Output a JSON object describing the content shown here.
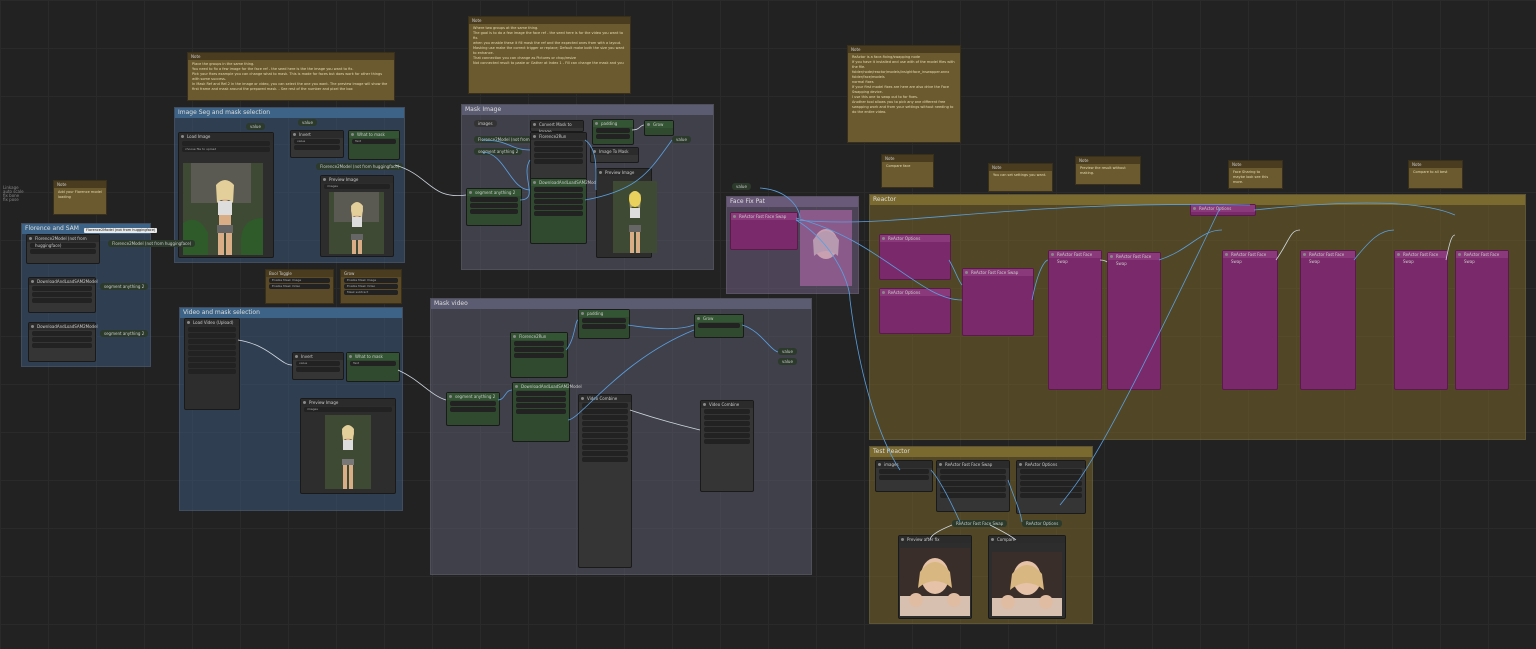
{
  "groups": {
    "image_mask_selection": "Image Seg and mask selection",
    "mask_image": "Mask Image",
    "face_fix": "Face Fix Pat",
    "reactor": "Reactor",
    "florence_sam": "Florence and SAM",
    "video_mask_selection": "Video and mask selection",
    "mask_video": "Mask video",
    "test_reactor": "Test Reactor"
  },
  "notes": {
    "title": "Note",
    "left_small": "Add your Florence model loading",
    "image_seg": "Place the groups in the same thing.\nYou need to fix a few image for the face ref - the seed here is the the image you want to fix.\nPick your fixes example you can change what to mask. This is made for faces but does work for other things with some success.\nIn Mask Ref and Ref-2 in the image or video, you can select the one you want. The preview image will show the first frame and mask around the prepared mask. - See rest of the number and pixel the box",
    "mask_image": "Where two groups at the same thing.\nThe goal is to do a few image the face ref - the seed here is for the video you want to fix.\nwhen you enable these it fill mask the ref and the expected ones from with a layout.\nMasking use make the correct trigger or replace; Default make both the size you want to enhance.\nThat connection you can change as Pictures or chop/resize\nNot connected result to paste or Gather at Index 1 - Fill can change the mask and you",
    "right_large": "ReActor is a face-fixing/swapping node\nIf you have it installed and use with of the model files with the file.\nfolder/node/reactor/models/insightface_inswapper.onnx\nfolder/face/models\nnormal fixes\nIf your first model fixes are here are also drive the Face Swapping device.\nI use this one to swap out to for fixes.\nAnother tool allows you to pick any one different free swapping work and from your settings without needing to do the entire video.",
    "r1": "Compare face",
    "r2": "You can set settings you want.",
    "r3": "Preview the result without making.",
    "r4": "Face Sharing to\nmaybe look see this more.",
    "r5": "Compare to all best"
  },
  "nodes": {
    "load_image": "Load Image",
    "choose_file": "choose file to upload",
    "preview_image": "Preview Image",
    "images": "images",
    "invert": "Invert",
    "value": "value",
    "what_mask": "What to mask",
    "text": "Text",
    "florence": "Florence2Model (not from huggingface)",
    "florence_run": "Florence2Run",
    "segment": "segment anything 2",
    "download_sam": "DownloadAndLoadSAM2Model",
    "load_video": "Load Video (Upload)",
    "video_combine": "Video Combine",
    "convert_mask": "Convert Mask to Image",
    "padding": "padding",
    "grow": "Grow",
    "image_to_mask": "Image To Mask",
    "bool_toggle": "Bool Toggle",
    "mask_sub": "Mask subtract",
    "reactor_face_swap": "ReActor Fast Face Swap",
    "reactor_options": "ReActor Options",
    "preview_after": "Preview after fix",
    "compare": "Compare",
    "enable_mask": "Enable Mask Image",
    "enable_video": "Enable Mask Video"
  },
  "tiny_labels": {
    "left_text": "Linkage\nauto scale\nfix bone\nfix pose"
  },
  "colors": {
    "wire_blue": "#5aa0e0",
    "wire_white": "#cfd8e0",
    "wire_green": "#7ad07a",
    "accent_magenta": "#a03a90"
  }
}
